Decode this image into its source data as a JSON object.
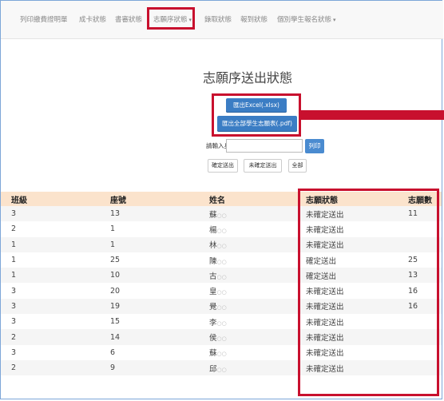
{
  "nav": {
    "items": [
      {
        "label": "列印繳費證明單",
        "caret": ""
      },
      {
        "label": "成卡狀態",
        "caret": ""
      },
      {
        "label": "書審狀態",
        "caret": ""
      },
      {
        "label": "志願序狀態",
        "caret": "▾"
      },
      {
        "label": "錄取狀態",
        "caret": ""
      },
      {
        "label": "報到狀態",
        "caret": ""
      },
      {
        "label": "個別學生報名狀態",
        "caret": "▾"
      }
    ]
  },
  "main": {
    "title": "志願序送出狀態",
    "export_excel": "匯出Excel(.xlsx)",
    "export_pdf": "匯出全部學生志願表(.pdf)",
    "id_label": "請輸入身分證",
    "id_value": "",
    "print_btn": "列印",
    "filter_confirmed": "確定送出",
    "filter_unconfirmed": "未確定送出",
    "filter_all": "全部"
  },
  "table": {
    "headers": [
      "班級",
      "座號",
      "姓名",
      "志願狀態",
      "志願數"
    ],
    "rows": [
      {
        "cls": "3",
        "seat": "13",
        "name": "蘇",
        "suffix": "○○",
        "status": "未確定送出",
        "count": "11"
      },
      {
        "cls": "2",
        "seat": "1",
        "name": "楊",
        "suffix": "○○",
        "status": "未確定送出",
        "count": ""
      },
      {
        "cls": "1",
        "seat": "1",
        "name": "林",
        "suffix": "○○",
        "status": "未確定送出",
        "count": ""
      },
      {
        "cls": "1",
        "seat": "25",
        "name": "陳",
        "suffix": "○○",
        "status": "確定送出",
        "count": "25"
      },
      {
        "cls": "1",
        "seat": "10",
        "name": "古",
        "suffix": "○○",
        "status": "確定送出",
        "count": "13"
      },
      {
        "cls": "3",
        "seat": "20",
        "name": "皇",
        "suffix": "○○",
        "status": "未確定送出",
        "count": "16"
      },
      {
        "cls": "3",
        "seat": "19",
        "name": "覺",
        "suffix": "○○",
        "status": "未確定送出",
        "count": "16"
      },
      {
        "cls": "3",
        "seat": "15",
        "name": "李",
        "suffix": "○○",
        "status": "未確定送出",
        "count": ""
      },
      {
        "cls": "2",
        "seat": "14",
        "name": "侯",
        "suffix": "○○",
        "status": "未確定送出",
        "count": ""
      },
      {
        "cls": "3",
        "seat": "6",
        "name": "蘇",
        "suffix": "○○",
        "status": "未確定送出",
        "count": ""
      },
      {
        "cls": "2",
        "seat": "9",
        "name": "邱",
        "suffix": "○○",
        "status": "未確定送出",
        "count": ""
      }
    ]
  },
  "colors": {
    "highlight": "#c8102e",
    "primary": "#3b7dc4",
    "header_bg": "#fbe3cc"
  }
}
